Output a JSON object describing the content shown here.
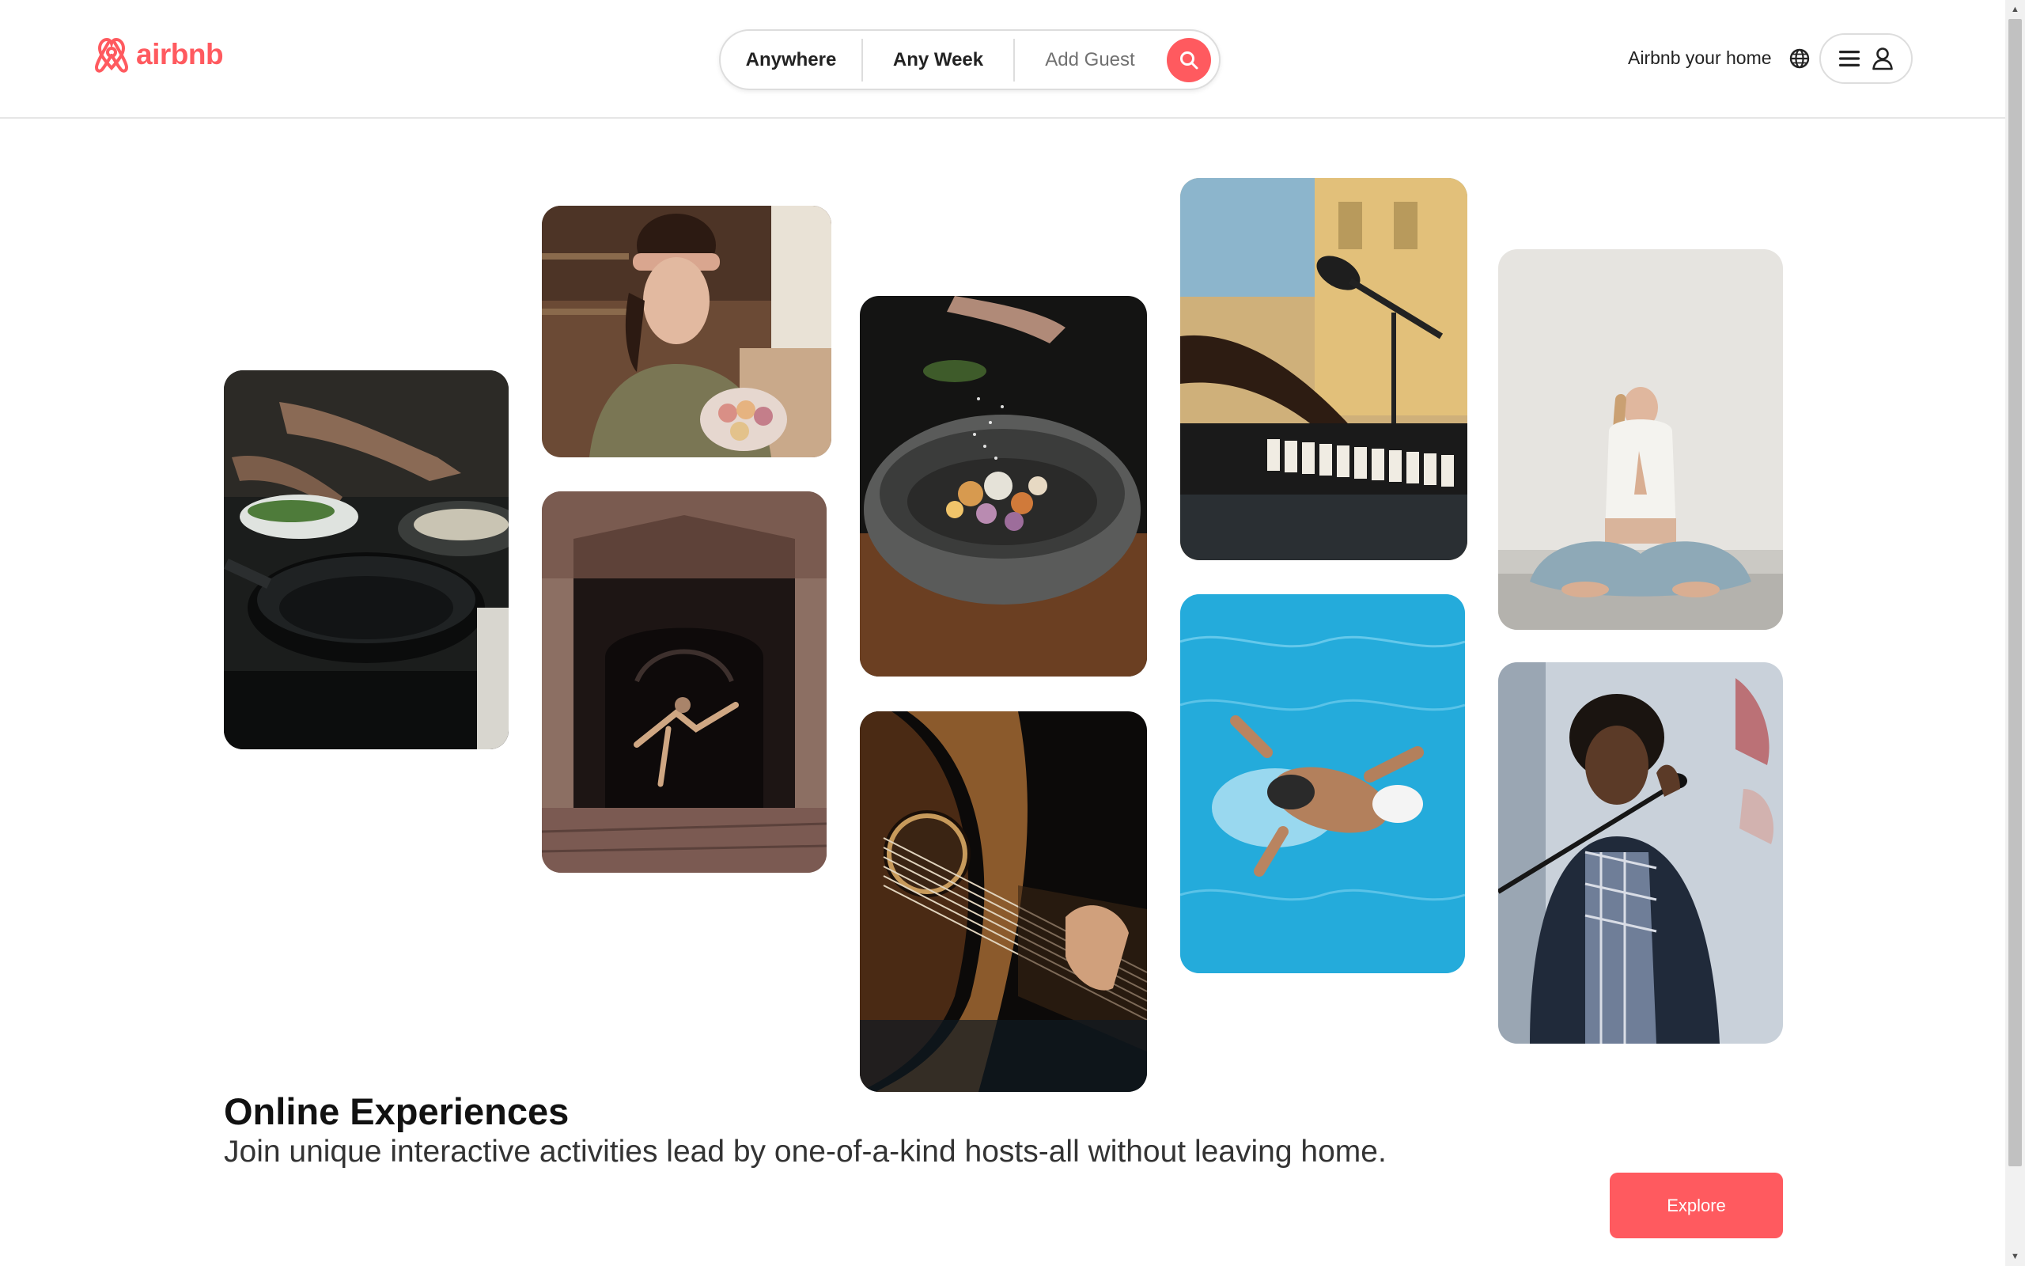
{
  "header": {
    "brand": "airbnb",
    "search": {
      "location": "Anywhere",
      "dates": "Any Week",
      "guests": "Add Guest"
    },
    "host_link": "Airbnb your home"
  },
  "colors": {
    "brand": "#ff5a5f",
    "text": "#222222",
    "muted": "#717171",
    "border": "#dddddd"
  },
  "icons": [
    "airbnb-logo-icon",
    "search-icon",
    "globe-icon",
    "hamburger-menu-icon",
    "user-icon"
  ],
  "gallery": [
    {
      "subject": "cooking-pans"
    },
    {
      "subject": "woman-with-macarons"
    },
    {
      "subject": "dancer-in-archway"
    },
    {
      "subject": "salting-bowl"
    },
    {
      "subject": "guitar-playing"
    },
    {
      "subject": "piano-and-microphone"
    },
    {
      "subject": "swimmer-in-pool"
    },
    {
      "subject": "yoga-meditation"
    },
    {
      "subject": "singer-at-microphone"
    }
  ],
  "hero": {
    "title": "Online Experiences",
    "subtitle": "Join unique interactive activities lead by one-of-a-kind hosts-all without leaving home.",
    "cta": "Explore"
  }
}
